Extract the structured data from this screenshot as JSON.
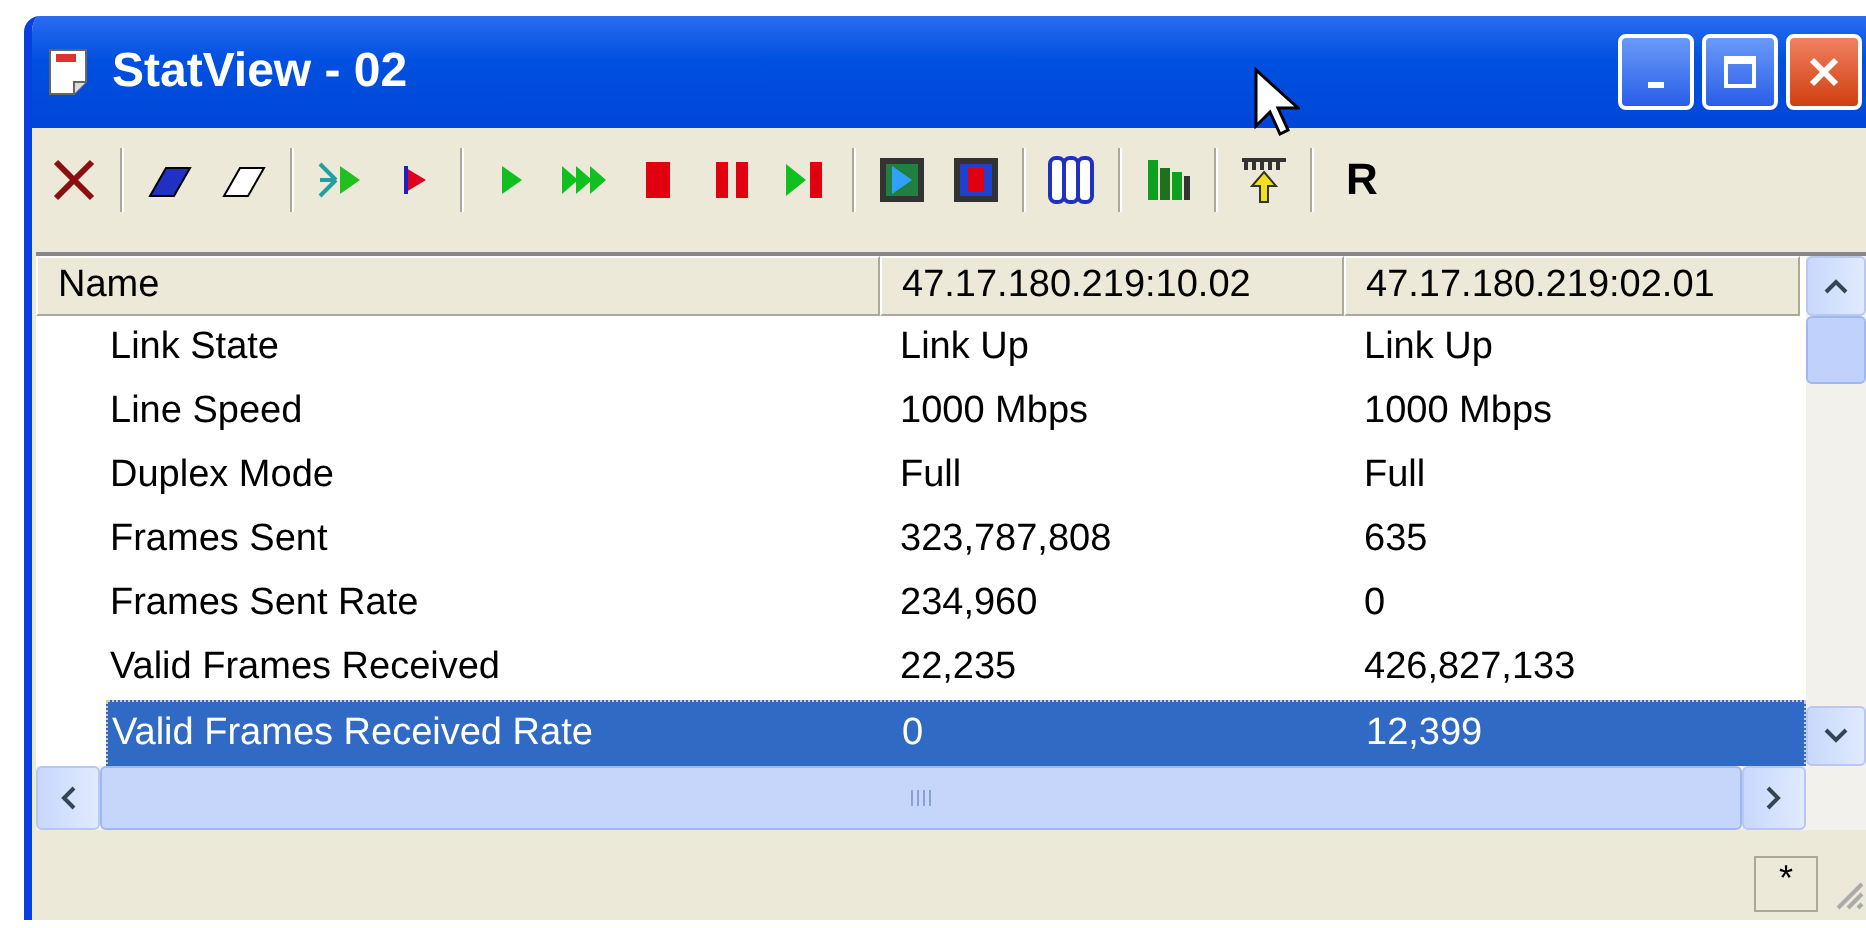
{
  "window": {
    "title": "StatView - 02"
  },
  "toolbar": {
    "text_button": "R"
  },
  "table": {
    "columns": [
      "Name",
      "47.17.180.219:10.02",
      "47.17.180.219:02.01"
    ],
    "rows": [
      {
        "cells": [
          "Link State",
          "Link Up",
          "Link Up"
        ],
        "selected": false
      },
      {
        "cells": [
          "Line Speed",
          "1000 Mbps",
          "1000 Mbps"
        ],
        "selected": false
      },
      {
        "cells": [
          "Duplex Mode",
          "Full",
          "Full"
        ],
        "selected": false
      },
      {
        "cells": [
          "Frames Sent",
          "323,787,808",
          "635"
        ],
        "selected": false
      },
      {
        "cells": [
          "Frames Sent Rate",
          "234,960",
          "0"
        ],
        "selected": false
      },
      {
        "cells": [
          "Valid Frames Received",
          "22,235",
          "426,827,133"
        ],
        "selected": false
      },
      {
        "cells": [
          "Valid Frames Received Rate",
          "0",
          "12,399"
        ],
        "selected": true
      }
    ]
  },
  "status_bar": {
    "panel": "*"
  }
}
